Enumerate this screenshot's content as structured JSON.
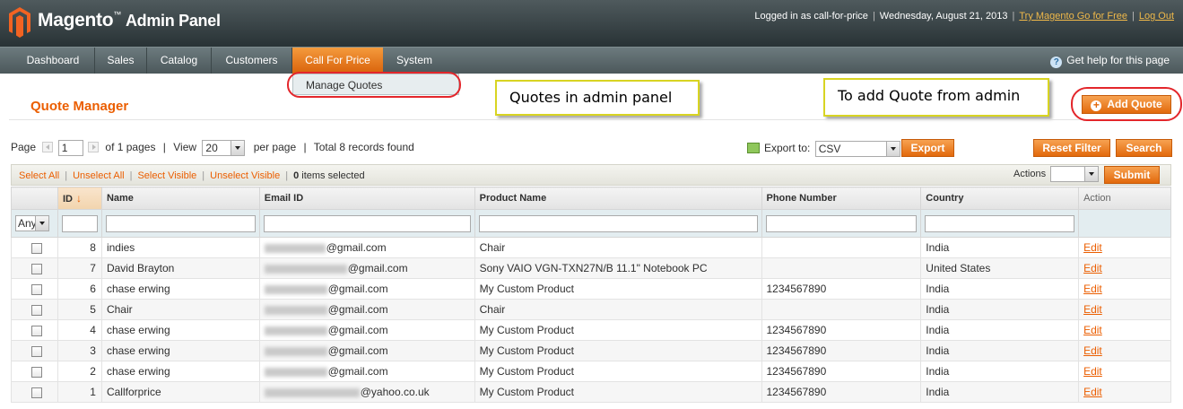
{
  "header": {
    "brand": "Magento",
    "brand_sub": "Admin Panel",
    "tm": "™",
    "logged_in": "Logged in as call-for-price",
    "date": "Wednesday, August 21, 2013",
    "try_link": "Try Magento Go for Free",
    "logout": "Log Out",
    "sep": "|"
  },
  "nav": {
    "items": [
      "Dashboard",
      "Sales",
      "Catalog",
      "Customers",
      "Call For Price",
      "System"
    ],
    "help": "Get help for this page",
    "help_icon": "?"
  },
  "dropdown": {
    "item": "Manage Quotes"
  },
  "callouts": {
    "left": "Quotes in admin panel",
    "right": "To add Quote from admin"
  },
  "page": {
    "title": "Quote Manager",
    "add_button": "Add Quote",
    "add_icon": "+"
  },
  "pager": {
    "page_label": "Page",
    "page_value": "1",
    "of_pages": "of 1 pages",
    "sep": "|",
    "view_label": "View",
    "per_page_value": "20",
    "per_page_label": "per page",
    "total": "Total 8 records found"
  },
  "export": {
    "label": "Export to:",
    "value": "CSV",
    "button": "Export"
  },
  "filters": {
    "reset": "Reset Filter",
    "search": "Search"
  },
  "massaction": {
    "select_all": "Select All",
    "unselect_all": "Unselect All",
    "select_visible": "Select Visible",
    "unselect_visible": "Unselect Visible",
    "sep": "|",
    "selected_count": "0",
    "selected_label": "items selected",
    "actions_label": "Actions",
    "submit": "Submit"
  },
  "grid": {
    "headers": {
      "id": "ID",
      "name": "Name",
      "email": "Email ID",
      "product": "Product Name",
      "phone": "Phone Number",
      "country": "Country",
      "action": "Action"
    },
    "sort_arrow": "↓",
    "any_option": "Any",
    "rows": [
      {
        "id": "8",
        "name": "indies",
        "email": "@gmail.com",
        "product": "Chair",
        "phone": "",
        "country": "India",
        "action": "Edit"
      },
      {
        "id": "7",
        "name": "David Brayton",
        "email": "@gmail.com",
        "product": "Sony VAIO VGN-TXN27N/B 11.1\" Notebook PC",
        "phone": "",
        "country": "United States",
        "action": "Edit"
      },
      {
        "id": "6",
        "name": "chase erwing",
        "email": "@gmail.com",
        "product": "My Custom Product",
        "phone": "1234567890",
        "country": "India",
        "action": "Edit"
      },
      {
        "id": "5",
        "name": "Chair",
        "email": "@gmail.com",
        "product": "Chair",
        "phone": "",
        "country": "India",
        "action": "Edit"
      },
      {
        "id": "4",
        "name": "chase erwing",
        "email": "@gmail.com",
        "product": "My Custom Product",
        "phone": "1234567890",
        "country": "India",
        "action": "Edit"
      },
      {
        "id": "3",
        "name": "chase erwing",
        "email": "@gmail.com",
        "product": "My Custom Product",
        "phone": "1234567890",
        "country": "India",
        "action": "Edit"
      },
      {
        "id": "2",
        "name": "chase erwing",
        "email": "@gmail.com",
        "product": "My Custom Product",
        "phone": "1234567890",
        "country": "India",
        "action": "Edit"
      },
      {
        "id": "1",
        "name": "Callforprice",
        "email": "@yahoo.co.uk",
        "product": "My Custom Product",
        "phone": "1234567890",
        "country": "India",
        "action": "Edit"
      }
    ]
  },
  "colors": {
    "accent": "#eb5e00",
    "header": "#283235",
    "nav": "#4c585b",
    "callout_border": "#d8d422",
    "annotation": "#e3262b"
  }
}
